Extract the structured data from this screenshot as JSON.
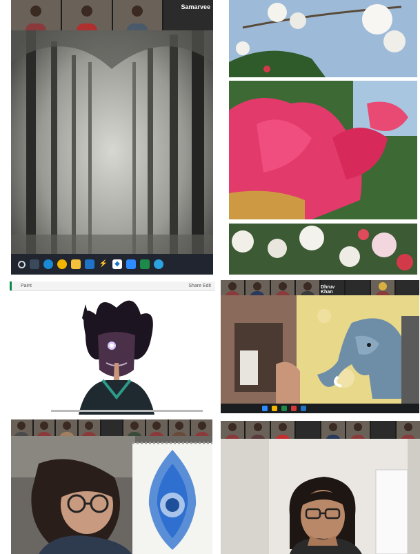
{
  "forest_panel": {
    "participant_name": "Samarvee",
    "thumbnail_count": 3,
    "taskbar_icons": [
      "start-icon",
      "search-icon",
      "edge-icon",
      "chrome-icon",
      "folder-icon",
      "mail-icon",
      "lightning-icon",
      "dropbox-icon",
      "zoom-icon",
      "excel-icon",
      "globe-icon"
    ]
  },
  "art_panel": {
    "window_title": "Paint",
    "toolbar_text": "Share  Edit"
  },
  "elephant_panel": {
    "participant_name": "Dhruv Khan",
    "thumbnail_count": 8
  },
  "mandala_panel": {
    "thumbnail_count": 9
  },
  "girl_panel": {
    "thumbnail_count": 8
  },
  "colors": {
    "flower_pink": "#e23a6a",
    "sky_blue": "#9dbbd8",
    "leaf_green": "#2f5a2a",
    "mandala_blue": "#2e6fd0",
    "elephant_blue": "#6e8ea8",
    "yellow_canvas": "#e8d88a"
  }
}
